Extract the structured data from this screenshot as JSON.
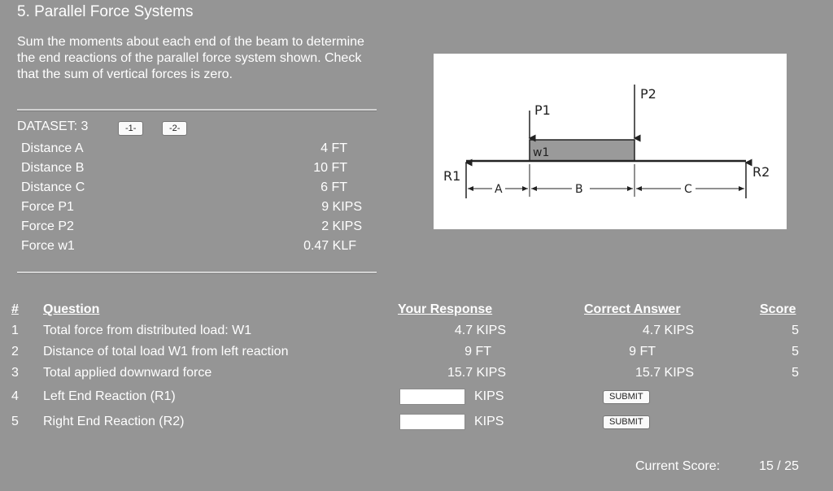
{
  "header": {
    "title": "5. Parallel Force Systems",
    "description": "Sum the moments about each end of the beam to determine the end reactions of the parallel force system shown. Check that the sum of vertical forces is zero."
  },
  "dataset": {
    "label": "DATASET: 3",
    "buttons": [
      "-1-",
      "-2-"
    ],
    "params": [
      {
        "name": "Distance A",
        "value": "4 FT"
      },
      {
        "name": "Distance B",
        "value": "10 FT"
      },
      {
        "name": "Distance C",
        "value": "6 FT"
      },
      {
        "name": "Force P1",
        "value": "9 KIPS"
      },
      {
        "name": "Force P2",
        "value": "2 KIPS"
      },
      {
        "name": "Force w1",
        "value": "0.47 KLF"
      }
    ]
  },
  "diagram": {
    "labels": {
      "p1": "P1",
      "p2": "P2",
      "w1": "w1",
      "r1": "R1",
      "r2": "R2",
      "a": "A",
      "b": "B",
      "c": "C"
    }
  },
  "table": {
    "headers": {
      "num": "#",
      "question": "Question",
      "response": "Your Response",
      "correct": "Correct Answer",
      "score": "Score"
    },
    "rows": [
      {
        "num": "1",
        "question": "Total force from distributed load: W1",
        "response": "4.7 KIPS",
        "correct": "4.7 KIPS",
        "score": "5"
      },
      {
        "num": "2",
        "question": "Distance of total load W1 from left reaction",
        "response": "9 FT",
        "correct": "9 FT",
        "score": "5"
      },
      {
        "num": "3",
        "question": "Total applied downward force",
        "response": "15.7 KIPS",
        "correct": "15.7 KIPS",
        "score": "5"
      },
      {
        "num": "4",
        "question": "Left End Reaction (R1)",
        "unit": "KIPS",
        "input_value": "",
        "submit": "SUBMIT"
      },
      {
        "num": "5",
        "question": "Right End Reaction (R2)",
        "unit": "KIPS",
        "input_value": "",
        "submit": "SUBMIT"
      }
    ]
  },
  "footer": {
    "label": "Current Score:",
    "value": "15 / 25"
  }
}
